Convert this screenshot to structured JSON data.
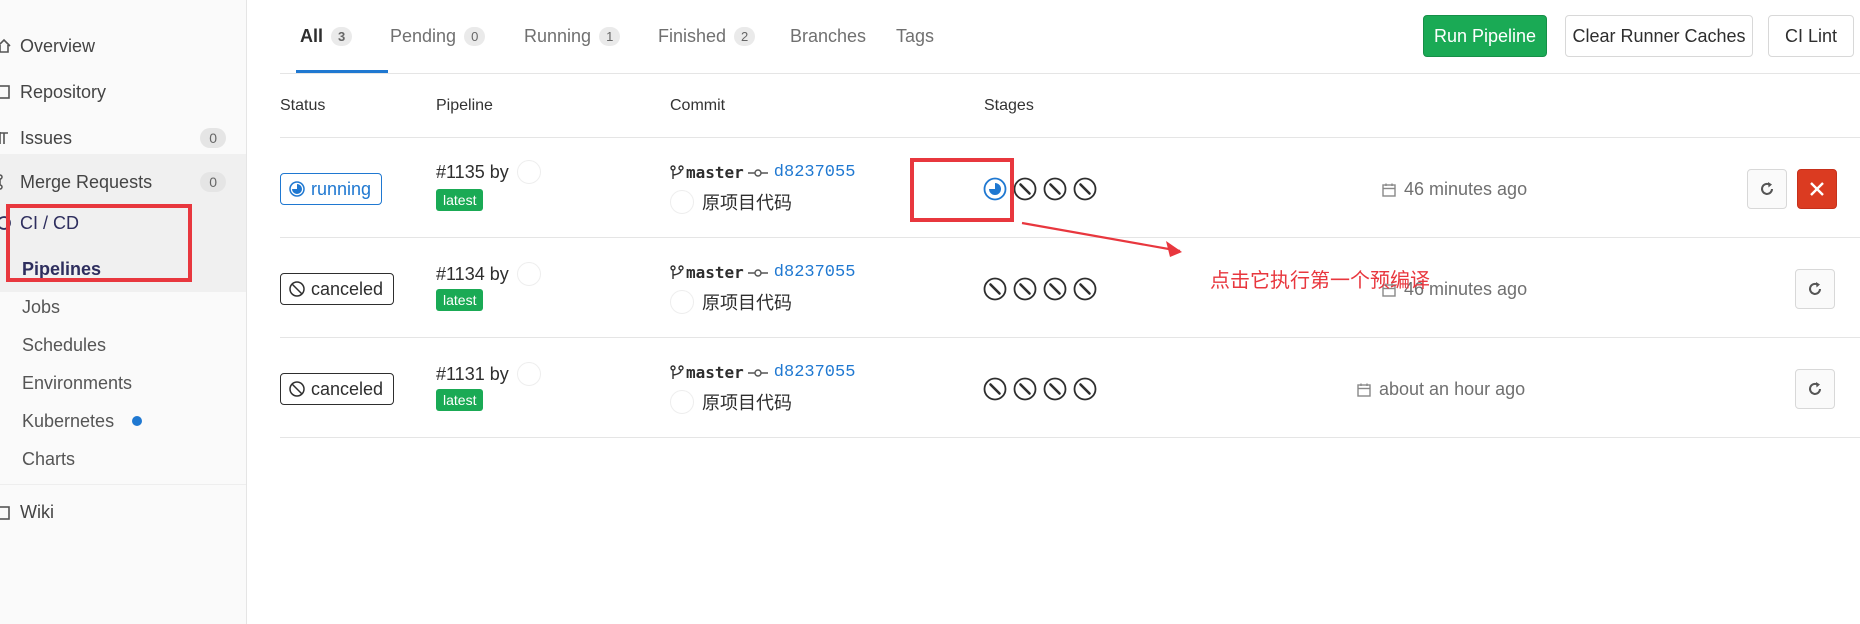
{
  "sidebar": {
    "items": [
      {
        "label": "Overview"
      },
      {
        "label": "Repository"
      },
      {
        "label": "Issues",
        "count": "0"
      },
      {
        "label": "Merge Requests",
        "count": "0"
      },
      {
        "label": "CI / CD"
      },
      {
        "label": "Wiki"
      }
    ],
    "cicd_sub": [
      {
        "label": "Pipelines"
      },
      {
        "label": "Jobs"
      },
      {
        "label": "Schedules"
      },
      {
        "label": "Environments"
      },
      {
        "label": "Kubernetes"
      },
      {
        "label": "Charts"
      }
    ]
  },
  "tabs": [
    {
      "label": "All",
      "count": "3"
    },
    {
      "label": "Pending",
      "count": "0"
    },
    {
      "label": "Running",
      "count": "1"
    },
    {
      "label": "Finished",
      "count": "2"
    },
    {
      "label": "Branches"
    },
    {
      "label": "Tags"
    }
  ],
  "buttons": {
    "run_pipeline": "Run Pipeline",
    "clear_caches": "Clear Runner Caches",
    "ci_lint": "CI Lint"
  },
  "table": {
    "headers": {
      "status": "Status",
      "pipeline": "Pipeline",
      "commit": "Commit",
      "stages": "Stages"
    },
    "rows": [
      {
        "status": "running",
        "id": "#1135 by",
        "tag": "latest",
        "branch": "master",
        "sha": "d8237055",
        "message": "原项目代码",
        "time": "46 minutes ago",
        "stages": [
          "running",
          "skipped",
          "skipped",
          "skipped"
        ]
      },
      {
        "status": "canceled",
        "id": "#1134 by",
        "tag": "latest",
        "branch": "master",
        "sha": "d8237055",
        "message": "原项目代码",
        "time": "46 minutes ago",
        "stages": [
          "skipped",
          "skipped",
          "skipped",
          "skipped"
        ]
      },
      {
        "status": "canceled",
        "id": "#1131 by",
        "tag": "latest",
        "branch": "master",
        "sha": "d8237055",
        "message": "原项目代码",
        "time": "about an hour ago",
        "stages": [
          "skipped",
          "skipped",
          "skipped",
          "skipped"
        ]
      }
    ]
  },
  "annotation": {
    "text": "点击它执行第一个预编译"
  },
  "colors": {
    "accent": "#1f78d1",
    "success": "#1aaa55",
    "danger": "#db3b21",
    "annotation": "#e8373e"
  }
}
